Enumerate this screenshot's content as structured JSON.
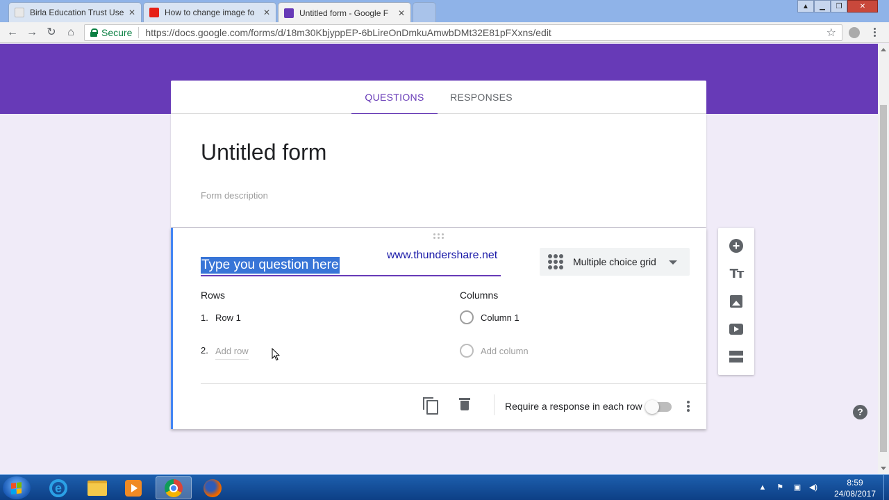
{
  "browser": {
    "tabs": [
      {
        "title": "Birla Education Trust Use",
        "favicon": "doc-icon",
        "active": false
      },
      {
        "title": "How to change image fo",
        "favicon": "youtube-icon",
        "active": false
      },
      {
        "title": "Untitled form - Google F",
        "favicon": "forms-icon",
        "active": true
      }
    ],
    "secure_label": "Secure",
    "url": "https://docs.google.com/forms/d/18m30KbjyppEP-6bLireOnDmkuAmwbDMt32E81pFXxns/edit"
  },
  "form": {
    "tabs": {
      "questions": "QUESTIONS",
      "responses": "RESPONSES"
    },
    "title": "Untitled form",
    "description_placeholder": "Form description",
    "question": {
      "text": "Type you question here",
      "watermark": "www.thundershare.net",
      "type": "Multiple choice grid",
      "rows_label": "Rows",
      "columns_label": "Columns",
      "rows": [
        {
          "num": "1.",
          "label": "Row 1"
        }
      ],
      "add_row": {
        "num": "2.",
        "label": "Add row"
      },
      "columns": [
        {
          "label": "Column 1"
        }
      ],
      "add_column": "Add column",
      "require_label": "Require a response in each row",
      "require_on": false
    }
  },
  "taskbar": {
    "time": "8:59",
    "date": "24/08/2017"
  },
  "colors": {
    "accent": "#673ab7",
    "banner": "#673ab7",
    "background": "#f0ebf8",
    "focus_border": "#4285f4"
  }
}
